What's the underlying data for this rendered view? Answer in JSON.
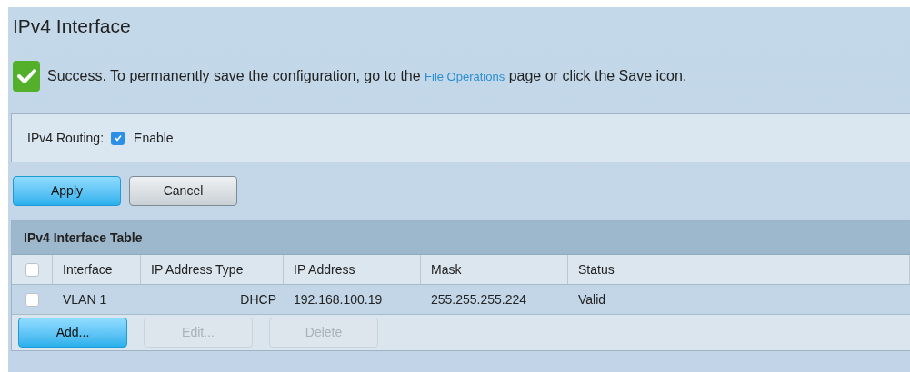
{
  "page_title": "IPv4 Interface",
  "message": {
    "before": "Success. To permanently save the configuration, go to the ",
    "link": "File Operations",
    "after": " page or click the Save icon."
  },
  "routing": {
    "label": "IPv4 Routing:",
    "checked": true,
    "option": "Enable"
  },
  "form_buttons": [
    {
      "label": "Apply",
      "kind": "primary",
      "disabled": false
    },
    {
      "label": "Cancel",
      "kind": "secondary",
      "disabled": false
    }
  ],
  "table": {
    "title": "IPv4 Interface Table",
    "columns": [
      "Interface",
      "IP Address Type",
      "IP Address",
      "Mask",
      "Status"
    ],
    "rows": [
      {
        "checked": false,
        "cells": [
          "VLAN 1",
          "DHCP",
          "192.168.100.19",
          "255.255.255.224",
          "Valid"
        ]
      }
    ],
    "header_checked": false,
    "buttons": [
      {
        "label": "Add...",
        "kind": "primary",
        "disabled": false
      },
      {
        "label": "Edit...",
        "kind": "secondary",
        "disabled": true
      },
      {
        "label": "Delete",
        "kind": "secondary",
        "disabled": true
      }
    ]
  }
}
